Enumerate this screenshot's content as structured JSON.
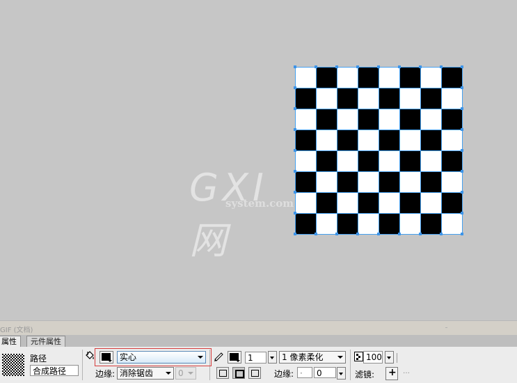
{
  "board": {
    "rows": 8,
    "cols": 8,
    "dark_color": "#000000",
    "light_color": "#ffffff",
    "grid_color": "#44a0f0",
    "handle_color": "#3d94e8",
    "first_cell": "light"
  },
  "watermark": {
    "big": "GXI网",
    "small": "system.com"
  },
  "doc_strip": {
    "title": "GIF (文档)"
  },
  "tabs": [
    {
      "label": "属性"
    },
    {
      "label": "元件属性"
    }
  ],
  "object": {
    "type": "路径",
    "name": "合成路径"
  },
  "fill": {
    "icon": "paint-bucket-icon",
    "color": "#000000",
    "type": "实心",
    "edge_label": "边缘:",
    "edge_value": "消除锯齿",
    "feather": "0"
  },
  "stroke": {
    "icon": "pencil-icon",
    "color": "#000000",
    "size": "1",
    "type": "1 像素柔化",
    "edge_label": "边缘:",
    "edge_value": "0"
  },
  "opacity": {
    "value": "100"
  },
  "filters": {
    "label": "滤镜:",
    "add_icon": "plus-icon"
  }
}
